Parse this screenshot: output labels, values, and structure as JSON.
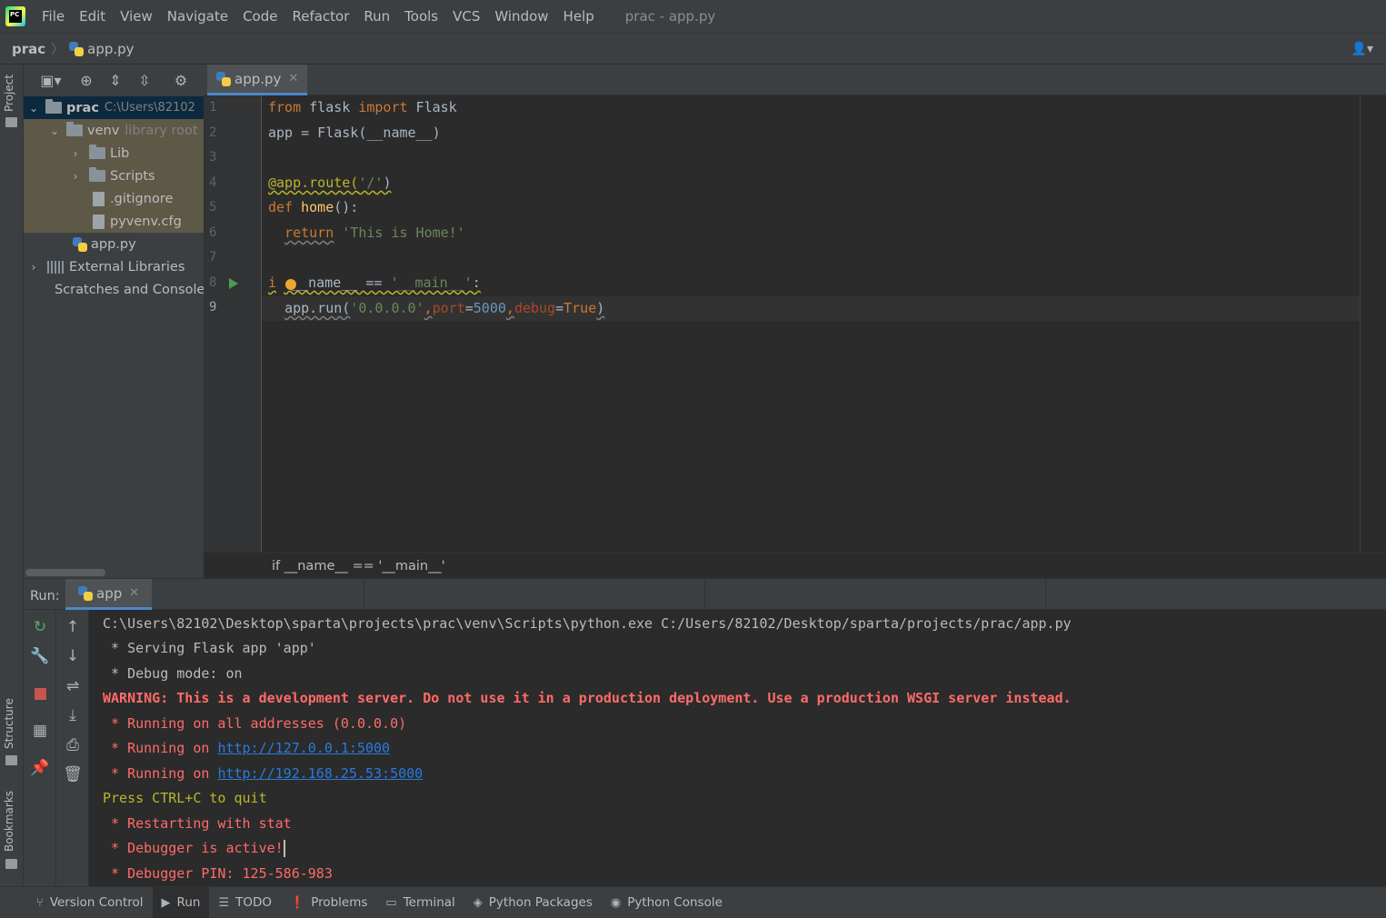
{
  "menubar": {
    "items": [
      "File",
      "Edit",
      "View",
      "Navigate",
      "Code",
      "Refactor",
      "Run",
      "Tools",
      "VCS",
      "Window",
      "Help"
    ],
    "window_title": "prac - app.py",
    "logo_text": "PC"
  },
  "navbar": {
    "project": "prac",
    "file": "app.py"
  },
  "left_stripe": {
    "project_tab": "Project",
    "structure_tab": "Structure",
    "bookmarks_tab": "Bookmarks"
  },
  "project_tree": {
    "root_name": "prac",
    "root_path": "C:\\Users\\82102",
    "venv_name": "venv",
    "venv_note": "library root",
    "lib": "Lib",
    "scripts": "Scripts",
    "gitignore": ".gitignore",
    "pyvenv": "pyvenv.cfg",
    "app_file": "app.py",
    "external_libraries": "External Libraries",
    "scratches": "Scratches and Consoles"
  },
  "editor": {
    "tab_label": "app.py",
    "line_numbers": [
      "1",
      "2",
      "3",
      "4",
      "5",
      "6",
      "7",
      "8",
      "9"
    ],
    "code": {
      "l1_kw1": "from",
      "l1_mod": " flask ",
      "l1_kw2": "import",
      "l1_cls": " Flask",
      "l2": "app = Flask(__name__)",
      "l4_dec": "@app.route(",
      "l4_str": "'/'",
      "l4_end": ")",
      "l5_kw": "def",
      "l5_fn": " home",
      "l5_end": "():",
      "l6_kw": "return",
      "l6_str": " 'This is Home!'",
      "l8_kw": "i",
      "l8_rest": " __name__ == ",
      "l8_str": "'__main__'",
      "l8_end": ":",
      "l9_a": "app.run(",
      "l9_str": "'0.0.0.0'",
      "l9_c1": ",",
      "l9_p1": "port",
      "l9_eq1": "=",
      "l9_num": "5000",
      "l9_c2": ",",
      "l9_p2": "debug",
      "l9_eq2": "=",
      "l9_true": "True",
      "l9_end": ")"
    },
    "breadcrumb": "if __name__ == '__main__'"
  },
  "run_panel": {
    "label": "Run:",
    "tab_label": "app",
    "console": {
      "cmd": "C:\\Users\\82102\\Desktop\\sparta\\projects\\prac\\venv\\Scripts\\python.exe C:/Users/82102/Desktop/sparta/projects/prac/app.py",
      "serving": " * Serving Flask app 'app'",
      "debug_mode": " * Debug mode: on",
      "warning": "WARNING: This is a development server. Do not use it in a production deployment. Use a production WSGI server instead.",
      "running_all": " * Running on all addresses (0.0.0.0)",
      "running_on_prefix": " * Running on ",
      "url1": "http://127.0.0.1:5000",
      "url2": "http://192.168.25.53:5000",
      "quit": "Press CTRL+C to quit",
      "restart": " * Restarting with stat",
      "debugger_active": " * Debugger is active!",
      "debugger_pin": " * Debugger PIN: 125-586-983"
    }
  },
  "bottom_bar": {
    "items": [
      "Version Control",
      "Run",
      "TODO",
      "Problems",
      "Terminal",
      "Python Packages",
      "Python Console"
    ]
  }
}
